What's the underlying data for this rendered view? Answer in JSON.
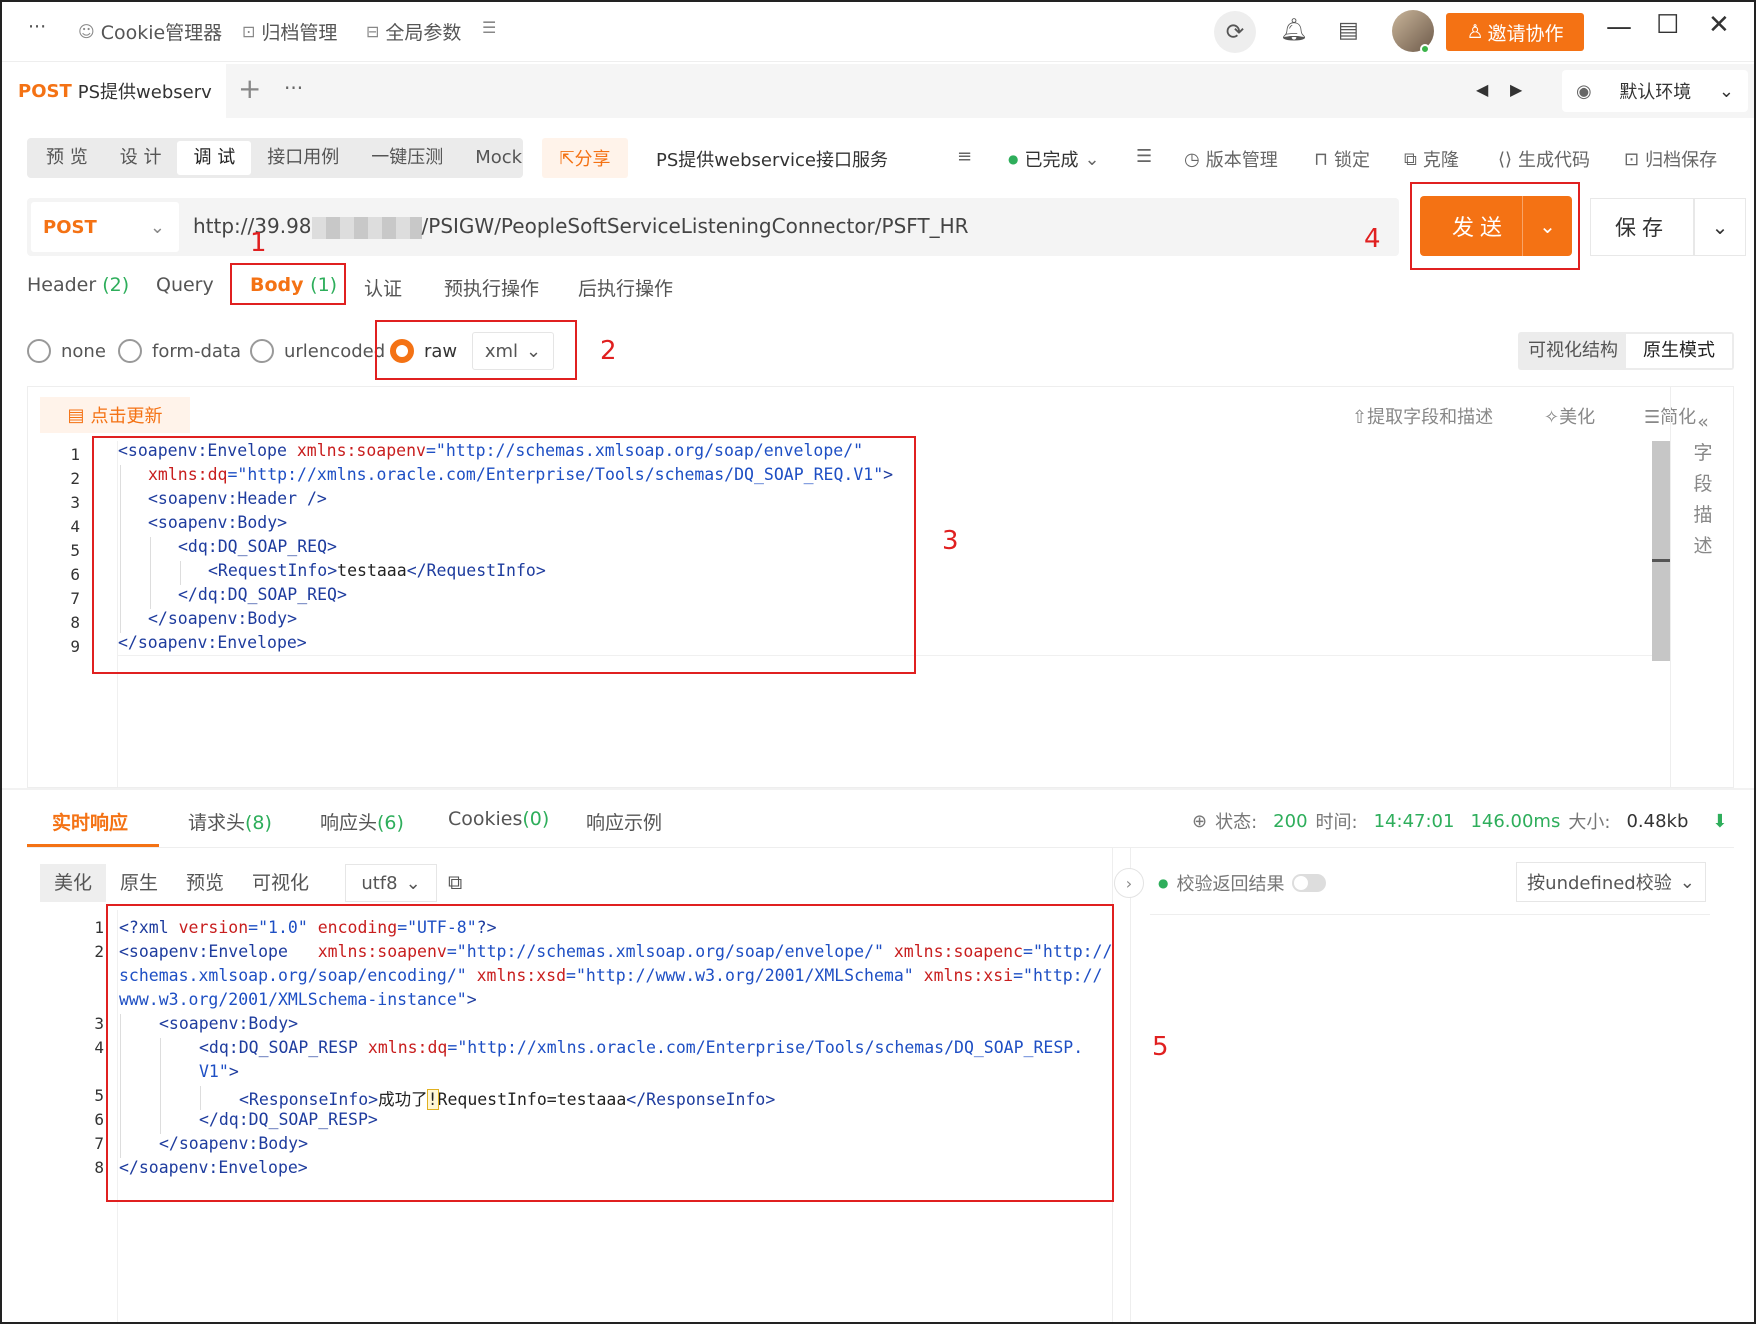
{
  "titlebar": {
    "menu": "···",
    "cookie_manager": "Cookie管理器",
    "archive_manage": "归档管理",
    "global_params": "全局参数",
    "invite_label": "邀请协作"
  },
  "tabstrip": {
    "tab_method": "POST",
    "tab_title": "PS提供webserv",
    "plus": "+",
    "more": "···",
    "env_label": "默认环境"
  },
  "subtoolbar": {
    "segments": [
      "预 览",
      "设 计",
      "调 试",
      "接口用例",
      "一键压测",
      "Mock"
    ],
    "share": "分享",
    "api_title": "PS提供webservice接口服务",
    "status": "已完成",
    "version": "版本管理",
    "lock": "锁定",
    "clone": "克隆",
    "gencode": "生成代码",
    "archive_save": "归档保存"
  },
  "urlbar": {
    "method": "POST",
    "url_prefix": "http://39.98",
    "url_suffix": "/PSIGW/PeopleSoftServiceListeningConnector/PSFT_HR",
    "send": "发送",
    "save": "保存"
  },
  "reqtabs": {
    "header": "Header",
    "header_count": "(2)",
    "query": "Query",
    "body": "Body",
    "body_count": "(1)",
    "auth": "认证",
    "pre": "预执行操作",
    "post": "后执行操作"
  },
  "bodytype": {
    "none": "none",
    "form": "form-data",
    "urlencoded": "urlencoded",
    "raw": "raw",
    "format": "xml",
    "visual": "可视化结构",
    "native": "原生模式"
  },
  "editor": {
    "update": "点击更新",
    "extract": "提取字段和描述",
    "beautify": "美化",
    "simplify": "简化",
    "side_label": [
      "字",
      "段",
      "描",
      "述"
    ],
    "lines": [
      "1",
      "2",
      "3",
      "4",
      "5",
      "6",
      "7",
      "8",
      "9"
    ]
  },
  "response": {
    "tabs": {
      "realtime": "实时响应",
      "reqheader": "请求头",
      "reqheader_count": "(8)",
      "respheader": "响应头",
      "respheader_count": "(6)",
      "cookies": "Cookies",
      "cookies_count": "(0)",
      "example": "响应示例"
    },
    "status_label": "状态:",
    "status_value": "200",
    "time_label": "时间:",
    "time_value": "14:47:01",
    "duration": "146.00ms",
    "size_label": "大小:",
    "size_value": "0.48kb",
    "views": [
      "美化",
      "原生",
      "预览",
      "可视化"
    ],
    "encoding": "utf8",
    "validate_label": "校验返回结果",
    "validate_select": "按undefined校验",
    "lines": [
      "1",
      "2",
      "3",
      "4",
      "5",
      "6",
      "7",
      "8"
    ]
  },
  "annotations": [
    "1",
    "2",
    "3",
    "4",
    "5"
  ],
  "colors": {
    "accent": "#f47214",
    "success": "#2eae5b",
    "annotation": "#e02020"
  }
}
